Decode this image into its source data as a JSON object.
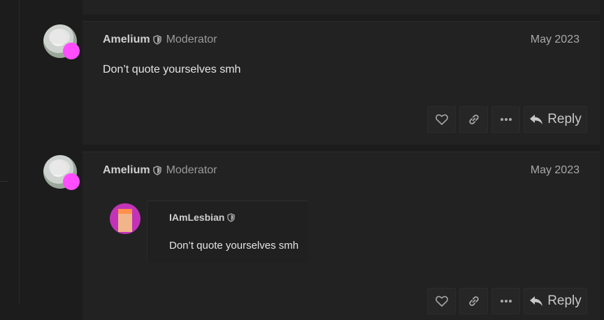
{
  "posts": [
    {
      "username": "Amelium",
      "role": "Moderator",
      "date": "May 2023",
      "body": "Don’t quote yourselves smh",
      "reply_label": "Reply"
    },
    {
      "username": "Amelium",
      "role": "Moderator",
      "date": "May 2023",
      "reply_label": "Reply",
      "quote": {
        "username": "IAmLesbian",
        "body": "Don’t quote yourselves smh"
      }
    }
  ],
  "colors": {
    "background": "#1c1c1c",
    "post_background": "#222222",
    "status_dot": "#ff4dff",
    "quote_avatar": "#c233b8"
  },
  "icons": [
    "shield-icon",
    "heart-icon",
    "link-icon",
    "more-icon",
    "reply-icon"
  ]
}
